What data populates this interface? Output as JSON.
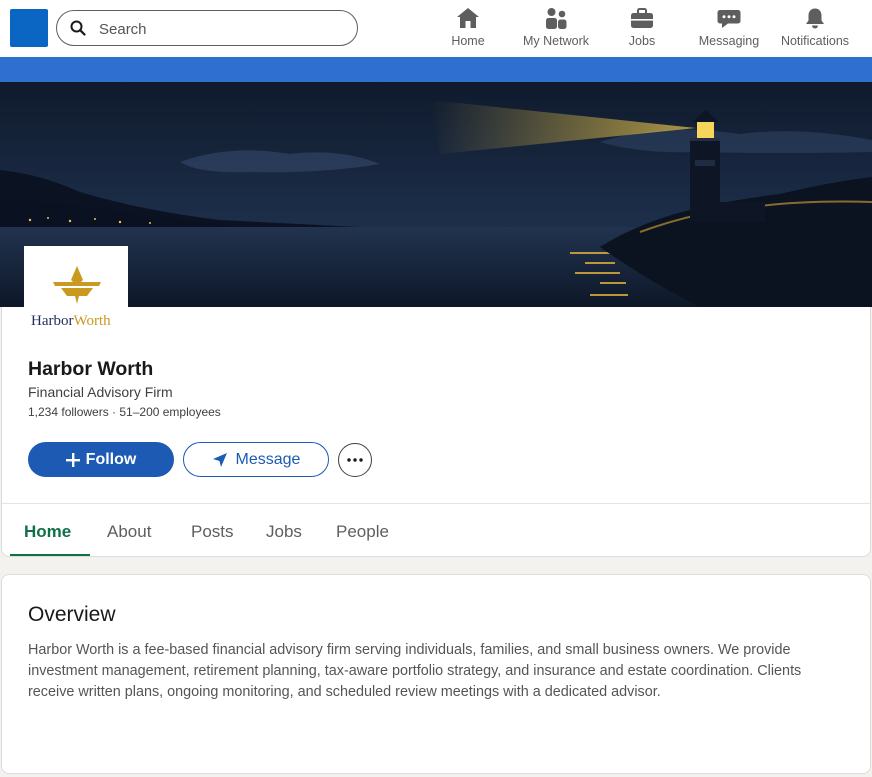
{
  "nav": {
    "search_placeholder": "Search",
    "items": [
      {
        "label": "Home",
        "icon": "home-icon"
      },
      {
        "label": "My Network",
        "icon": "people-icon"
      },
      {
        "label": "Jobs",
        "icon": "briefcase-icon"
      },
      {
        "label": "Messaging",
        "icon": "chat-icon"
      },
      {
        "label": "Notifications",
        "icon": "bell-icon"
      }
    ]
  },
  "colors": {
    "brand_blue": "#0a66c2",
    "button_blue": "#1c5ab4",
    "active_tab_green": "#10704a",
    "logo_navy": "#1e2f5a",
    "logo_gold": "#c99a1f"
  },
  "company": {
    "logo_word_1": "Harbor",
    "logo_word_2": "Worth",
    "name": "Harbor Worth",
    "type": "Financial Advisory Firm",
    "stats": "1,234 followers · 51–200 employees"
  },
  "actions": {
    "follow_label": "Follow",
    "message_label": "Message"
  },
  "tabs": [
    "Home",
    "About",
    "Posts",
    "Jobs",
    "People"
  ],
  "overview": {
    "title": "Overview",
    "body": "Harbor Worth is a fee-based financial advisory firm serving individuals, families, and small business owners. We provide investment management, retirement planning, tax-aware portfolio strategy, and insurance and estate coordination. Clients receive written plans, ongoing monitoring, and scheduled review meetings with a dedicated advisor."
  }
}
